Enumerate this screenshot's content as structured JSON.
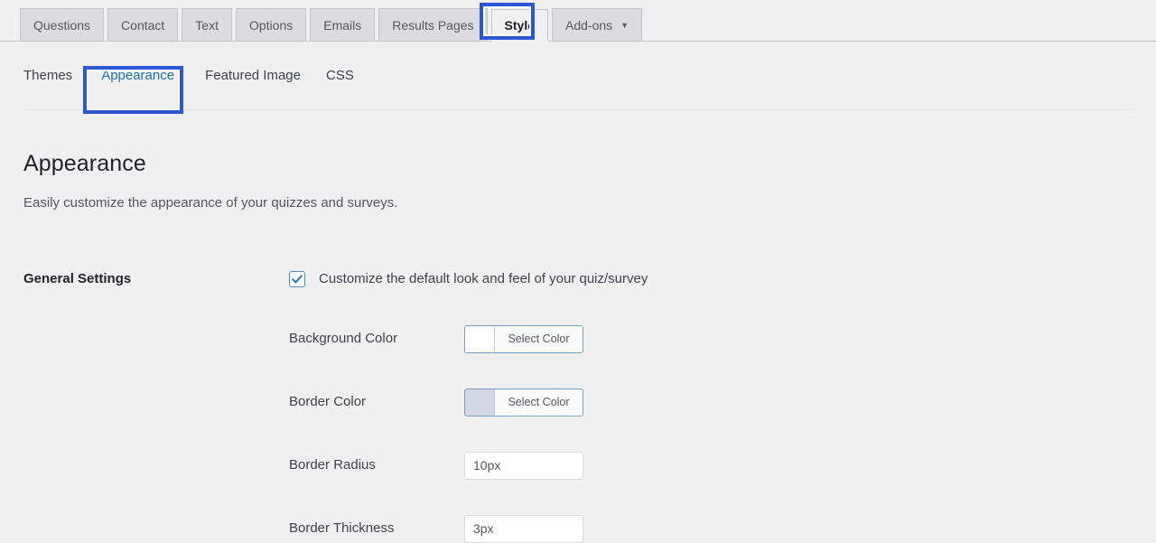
{
  "top_tabs": {
    "items": [
      {
        "id": "questions",
        "label": "Questions",
        "active": false,
        "caret": false
      },
      {
        "id": "contact",
        "label": "Contact",
        "active": false,
        "caret": false
      },
      {
        "id": "text",
        "label": "Text",
        "active": false,
        "caret": false
      },
      {
        "id": "options",
        "label": "Options",
        "active": false,
        "caret": false
      },
      {
        "id": "emails",
        "label": "Emails",
        "active": false,
        "caret": false
      },
      {
        "id": "results-pages",
        "label": "Results Pages",
        "active": false,
        "caret": false
      },
      {
        "id": "style",
        "label": "Style",
        "active": true,
        "caret": false
      },
      {
        "id": "add-ons",
        "label": "Add-ons",
        "active": false,
        "caret": true
      }
    ],
    "caret_glyph": "▼"
  },
  "sub_tabs": {
    "items": [
      {
        "id": "themes",
        "label": "Themes",
        "active": false
      },
      {
        "id": "appearance",
        "label": "Appearance",
        "active": true
      },
      {
        "id": "featured-image",
        "label": "Featured Image",
        "active": false
      },
      {
        "id": "css",
        "label": "CSS",
        "active": false
      }
    ]
  },
  "page": {
    "title": "Appearance",
    "subtitle": "Easily customize the appearance of your quizzes and surveys."
  },
  "general_settings": {
    "section_label": "General Settings",
    "customize_checkbox": {
      "label": "Customize the default look and feel of your quiz/survey",
      "checked": true
    },
    "fields": [
      {
        "id": "background-color",
        "label": "Background Color",
        "type": "color",
        "button_label": "Select Color",
        "swatch_color": "#ffffff"
      },
      {
        "id": "border-color",
        "label": "Border Color",
        "type": "color",
        "button_label": "Select Color",
        "swatch_color": "#d3d6e4"
      },
      {
        "id": "border-radius",
        "label": "Border Radius",
        "type": "text",
        "value": "10px",
        "placeholder": "10px"
      },
      {
        "id": "border-thickness",
        "label": "Border Thickness",
        "type": "text",
        "value": "3px",
        "placeholder": "3px"
      }
    ]
  },
  "annotations": {
    "style_tab_highlight_color": "#2b57d6",
    "appearance_subtab_highlight_color": "#2b57d6"
  },
  "theme": {
    "page_background": "#f0f0f1",
    "tab_background": "#dcdcde",
    "accent": "#2271b1"
  }
}
